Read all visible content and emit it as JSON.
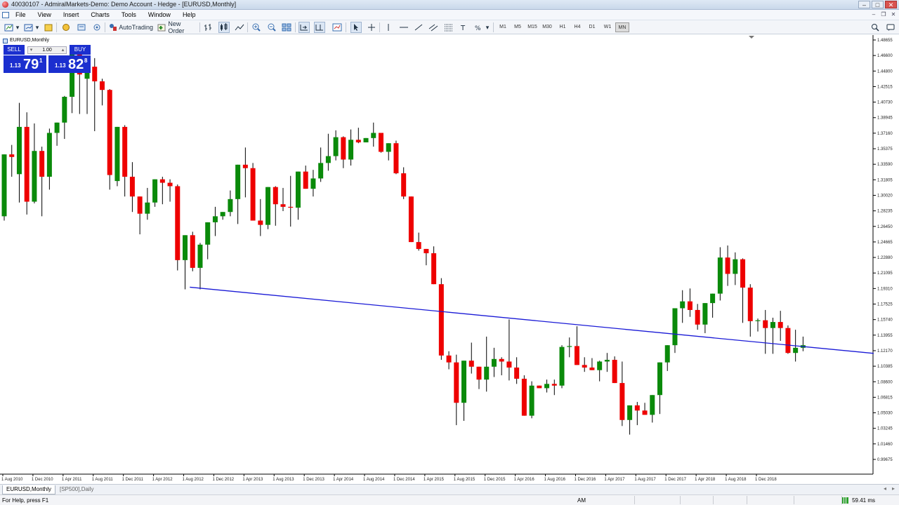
{
  "window": {
    "title": "40030107 - AdmiralMarkets-Demo: Demo Account - Hedge - [EURUSD,Monthly]"
  },
  "menu": [
    "File",
    "View",
    "Insert",
    "Charts",
    "Tools",
    "Window",
    "Help"
  ],
  "toolbar": {
    "autotrading_label": "AutoTrading",
    "new_order_label": "New Order",
    "timeframes": [
      "M1",
      "M5",
      "M15",
      "M30",
      "H1",
      "H4",
      "D1",
      "W1",
      "MN"
    ],
    "active_timeframe": "MN"
  },
  "chart_window": {
    "symbol_label": "EURUSD,Monthly"
  },
  "one_click": {
    "sell_label": "SELL",
    "buy_label": "BUY",
    "lot": "1.00",
    "sell_prefix": "1.13",
    "sell_big": "79",
    "sell_sup": "1",
    "buy_prefix": "1.13",
    "buy_big": "82",
    "buy_sup": "8"
  },
  "tabs": [
    "EURUSD,Monthly",
    "[SP500],Daily"
  ],
  "active_tab": "EURUSD,Monthly",
  "status": {
    "help": "For Help, press F1",
    "time": "AM",
    "connection": "59.41 ms"
  },
  "colors": {
    "bull": "#0a8a0a",
    "bear": "#ee0000",
    "trendline": "#1a1ad6",
    "quote_panel": "#1b2fcf"
  },
  "chart_data": {
    "type": "candlestick",
    "symbol": "EURUSD",
    "timeframe": "Monthly",
    "ylim": [
      0.99,
      1.5
    ],
    "y_ticks": [
      "1.48655",
      "1.46600",
      "1.44800",
      "1.42515",
      "1.40730",
      "1.38945",
      "1.37160",
      "1.35375",
      "1.33590",
      "1.31805",
      "1.30020",
      "1.28235",
      "1.26450",
      "1.24665",
      "1.22880",
      "1.21095",
      "1.19310",
      "1.17525",
      "1.15740",
      "1.13955",
      "1.12170",
      "1.10385",
      "1.08600",
      "1.06815",
      "1.05030",
      "1.03245",
      "1.01460",
      "0.99675"
    ],
    "x_ticks": [
      "1 Aug 2010",
      "1 Dec 2010",
      "1 Apr 2011",
      "1 Aug 2011",
      "1 Dec 2011",
      "1 Apr 2012",
      "1 Aug 2012",
      "1 Dec 2012",
      "1 Apr 2013",
      "1 Aug 2013",
      "1 Dec 2013",
      "1 Apr 2014",
      "1 Aug 2014",
      "1 Dec 2014",
      "1 Apr 2015",
      "1 Aug 2015",
      "1 Dec 2015",
      "1 Apr 2016",
      "1 Aug 2016",
      "1 Dec 2016",
      "1 Apr 2017",
      "1 Aug 2017",
      "1 Dec 2017",
      "1 Apr 2018",
      "1 Aug 2018",
      "1 Dec 2018"
    ],
    "candles": [
      {
        "o": 1.29,
        "h": 1.345,
        "l": 1.285,
        "c": 1.362
      },
      {
        "o": 1.362,
        "h": 1.373,
        "l": 1.336,
        "c": 1.359
      },
      {
        "o": 1.339,
        "h": 1.422,
        "l": 1.306,
        "c": 1.394
      },
      {
        "o": 1.394,
        "h": 1.411,
        "l": 1.292,
        "c": 1.307
      },
      {
        "o": 1.307,
        "h": 1.398,
        "l": 1.305,
        "c": 1.366
      },
      {
        "o": 1.366,
        "h": 1.371,
        "l": 1.29,
        "c": 1.336
      },
      {
        "o": 1.336,
        "h": 1.392,
        "l": 1.321,
        "c": 1.387
      },
      {
        "o": 1.387,
        "h": 1.398,
        "l": 1.372,
        "c": 1.399
      },
      {
        "o": 1.399,
        "h": 1.43,
        "l": 1.38,
        "c": 1.429
      },
      {
        "o": 1.429,
        "h": 1.469,
        "l": 1.41,
        "c": 1.483
      },
      {
        "o": 1.483,
        "h": 1.488,
        "l": 1.409,
        "c": 1.455
      },
      {
        "o": 1.45,
        "h": 1.473,
        "l": 1.409,
        "c": 1.464
      },
      {
        "o": 1.464,
        "h": 1.474,
        "l": 1.389,
        "c": 1.447
      },
      {
        "o": 1.447,
        "h": 1.45,
        "l": 1.419,
        "c": 1.437
      },
      {
        "o": 1.437,
        "h": 1.438,
        "l": 1.321,
        "c": 1.338
      },
      {
        "o": 1.331,
        "h": 1.357,
        "l": 1.325,
        "c": 1.394
      },
      {
        "o": 1.394,
        "h": 1.396,
        "l": 1.313,
        "c": 1.336
      },
      {
        "o": 1.336,
        "h": 1.353,
        "l": 1.295,
        "c": 1.313
      },
      {
        "o": 1.313,
        "h": 1.301,
        "l": 1.269,
        "c": 1.293
      },
      {
        "o": 1.293,
        "h": 1.323,
        "l": 1.286,
        "c": 1.306
      },
      {
        "o": 1.306,
        "h": 1.333,
        "l": 1.301,
        "c": 1.333
      },
      {
        "o": 1.333,
        "h": 1.336,
        "l": 1.304,
        "c": 1.329
      },
      {
        "o": 1.329,
        "h": 1.333,
        "l": 1.307,
        "c": 1.325
      },
      {
        "o": 1.325,
        "h": 1.327,
        "l": 1.227,
        "c": 1.239
      },
      {
        "o": 1.239,
        "h": 1.266,
        "l": 1.205,
        "c": 1.268
      },
      {
        "o": 1.268,
        "h": 1.272,
        "l": 1.226,
        "c": 1.23
      },
      {
        "o": 1.23,
        "h": 1.259,
        "l": 1.205,
        "c": 1.257
      },
      {
        "o": 1.257,
        "h": 1.267,
        "l": 1.24,
        "c": 1.283
      },
      {
        "o": 1.283,
        "h": 1.301,
        "l": 1.267,
        "c": 1.29
      },
      {
        "o": 1.29,
        "h": 1.292,
        "l": 1.286,
        "c": 1.295
      },
      {
        "o": 1.295,
        "h": 1.32,
        "l": 1.29,
        "c": 1.31
      },
      {
        "o": 1.31,
        "h": 1.326,
        "l": 1.281,
        "c": 1.35
      },
      {
        "o": 1.35,
        "h": 1.37,
        "l": 1.312,
        "c": 1.346
      },
      {
        "o": 1.346,
        "h": 1.352,
        "l": 1.296,
        "c": 1.285
      },
      {
        "o": 1.285,
        "h": 1.31,
        "l": 1.267,
        "c": 1.28
      },
      {
        "o": 1.28,
        "h": 1.312,
        "l": 1.275,
        "c": 1.324
      },
      {
        "o": 1.324,
        "h": 1.325,
        "l": 1.279,
        "c": 1.304
      },
      {
        "o": 1.304,
        "h": 1.323,
        "l": 1.296,
        "c": 1.301
      },
      {
        "o": 1.301,
        "h": 1.337,
        "l": 1.278,
        "c": 1.3
      },
      {
        "o": 1.3,
        "h": 1.305,
        "l": 1.286,
        "c": 1.342
      },
      {
        "o": 1.342,
        "h": 1.349,
        "l": 1.325,
        "c": 1.322
      },
      {
        "o": 1.322,
        "h": 1.344,
        "l": 1.313,
        "c": 1.334
      },
      {
        "o": 1.334,
        "h": 1.37,
        "l": 1.33,
        "c": 1.352
      },
      {
        "o": 1.352,
        "h": 1.386,
        "l": 1.343,
        "c": 1.36
      },
      {
        "o": 1.36,
        "h": 1.39,
        "l": 1.355,
        "c": 1.382
      },
      {
        "o": 1.382,
        "h": 1.383,
        "l": 1.346,
        "c": 1.356
      },
      {
        "o": 1.356,
        "h": 1.391,
        "l": 1.349,
        "c": 1.379
      },
      {
        "o": 1.379,
        "h": 1.393,
        "l": 1.375,
        "c": 1.376
      },
      {
        "o": 1.376,
        "h": 1.38,
        "l": 1.377,
        "c": 1.381
      },
      {
        "o": 1.381,
        "h": 1.399,
        "l": 1.371,
        "c": 1.387
      },
      {
        "o": 1.387,
        "h": 1.384,
        "l": 1.364,
        "c": 1.365
      },
      {
        "o": 1.365,
        "h": 1.375,
        "l": 1.355,
        "c": 1.375
      },
      {
        "o": 1.375,
        "h": 1.378,
        "l": 1.339,
        "c": 1.34
      },
      {
        "o": 1.34,
        "h": 1.347,
        "l": 1.31,
        "c": 1.313
      },
      {
        "o": 1.313,
        "h": 1.309,
        "l": 1.262,
        "c": 1.26
      },
      {
        "o": 1.26,
        "h": 1.271,
        "l": 1.25,
        "c": 1.252
      },
      {
        "o": 1.252,
        "h": 1.25,
        "l": 1.233,
        "c": 1.247
      },
      {
        "o": 1.247,
        "h": 1.255,
        "l": 1.227,
        "c": 1.211
      },
      {
        "o": 1.211,
        "h": 1.218,
        "l": 1.123,
        "c": 1.128
      },
      {
        "o": 1.128,
        "h": 1.133,
        "l": 1.112,
        "c": 1.12
      },
      {
        "o": 1.12,
        "h": 1.129,
        "l": 1.047,
        "c": 1.073
      },
      {
        "o": 1.073,
        "h": 1.12,
        "l": 1.052,
        "c": 1.122
      },
      {
        "o": 1.122,
        "h": 1.143,
        "l": 1.107,
        "c": 1.115
      },
      {
        "o": 1.115,
        "h": 1.113,
        "l": 1.089,
        "c": 1.1
      },
      {
        "o": 1.1,
        "h": 1.15,
        "l": 1.086,
        "c": 1.115
      },
      {
        "o": 1.115,
        "h": 1.137,
        "l": 1.103,
        "c": 1.124
      },
      {
        "o": 1.124,
        "h": 1.126,
        "l": 1.105,
        "c": 1.121
      },
      {
        "o": 1.121,
        "h": 1.17,
        "l": 1.099,
        "c": 1.114
      },
      {
        "o": 1.114,
        "h": 1.126,
        "l": 1.095,
        "c": 1.101
      },
      {
        "o": 1.101,
        "h": 1.105,
        "l": 1.058,
        "c": 1.058
      },
      {
        "o": 1.058,
        "h": 1.098,
        "l": 1.055,
        "c": 1.093
      },
      {
        "o": 1.093,
        "h": 1.092,
        "l": 1.09,
        "c": 1.09
      },
      {
        "o": 1.09,
        "h": 1.1,
        "l": 1.085,
        "c": 1.095
      },
      {
        "o": 1.095,
        "h": 1.1,
        "l": 1.082,
        "c": 1.093
      },
      {
        "o": 1.093,
        "h": 1.14,
        "l": 1.09,
        "c": 1.138
      },
      {
        "o": 1.138,
        "h": 1.149,
        "l": 1.126,
        "c": 1.139
      },
      {
        "o": 1.139,
        "h": 1.162,
        "l": 1.121,
        "c": 1.117
      },
      {
        "o": 1.117,
        "h": 1.126,
        "l": 1.109,
        "c": 1.114
      },
      {
        "o": 1.114,
        "h": 1.125,
        "l": 1.111,
        "c": 1.111
      },
      {
        "o": 1.111,
        "h": 1.122,
        "l": 1.098,
        "c": 1.121
      },
      {
        "o": 1.121,
        "h": 1.131,
        "l": 1.109,
        "c": 1.123
      },
      {
        "o": 1.123,
        "h": 1.127,
        "l": 1.098,
        "c": 1.096
      },
      {
        "o": 1.096,
        "h": 1.121,
        "l": 1.046,
        "c": 1.053
      },
      {
        "o": 1.053,
        "h": 1.064,
        "l": 1.036,
        "c": 1.07
      },
      {
        "o": 1.07,
        "h": 1.074,
        "l": 1.047,
        "c": 1.064
      },
      {
        "o": 1.064,
        "h": 1.073,
        "l": 1.064,
        "c": 1.059
      },
      {
        "o": 1.059,
        "h": 1.069,
        "l": 1.05,
        "c": 1.082
      },
      {
        "o": 1.082,
        "h": 1.093,
        "l": 1.06,
        "c": 1.12
      },
      {
        "o": 1.12,
        "h": 1.128,
        "l": 1.11,
        "c": 1.14
      },
      {
        "o": 1.14,
        "h": 1.162,
        "l": 1.131,
        "c": 1.183
      },
      {
        "o": 1.183,
        "h": 1.204,
        "l": 1.166,
        "c": 1.191
      },
      {
        "o": 1.191,
        "h": 1.206,
        "l": 1.173,
        "c": 1.181
      },
      {
        "o": 1.181,
        "h": 1.188,
        "l": 1.158,
        "c": 1.164
      },
      {
        "o": 1.164,
        "h": 1.183,
        "l": 1.154,
        "c": 1.189
      },
      {
        "o": 1.189,
        "h": 1.199,
        "l": 1.172,
        "c": 1.2
      },
      {
        "o": 1.2,
        "h": 1.254,
        "l": 1.192,
        "c": 1.242
      },
      {
        "o": 1.242,
        "h": 1.256,
        "l": 1.209,
        "c": 1.223
      },
      {
        "o": 1.223,
        "h": 1.248,
        "l": 1.21,
        "c": 1.24
      },
      {
        "o": 1.24,
        "h": 1.241,
        "l": 1.166,
        "c": 1.207
      },
      {
        "o": 1.207,
        "h": 1.211,
        "l": 1.15,
        "c": 1.168
      },
      {
        "o": 1.168,
        "h": 1.171,
        "l": 1.156,
        "c": 1.169
      },
      {
        "o": 1.169,
        "h": 1.181,
        "l": 1.13,
        "c": 1.16
      },
      {
        "o": 1.16,
        "h": 1.172,
        "l": 1.13,
        "c": 1.167
      },
      {
        "o": 1.167,
        "h": 1.18,
        "l": 1.145,
        "c": 1.16
      },
      {
        "o": 1.16,
        "h": 1.163,
        "l": 1.13,
        "c": 1.131
      },
      {
        "o": 1.131,
        "h": 1.158,
        "l": 1.121,
        "c": 1.137
      },
      {
        "o": 1.137,
        "h": 1.15,
        "l": 1.133,
        "c": 1.14
      }
    ],
    "trendline": {
      "from_index": 25,
      "from_price": 1.2075,
      "to_index": 115,
      "to_price": 1.1305
    }
  }
}
